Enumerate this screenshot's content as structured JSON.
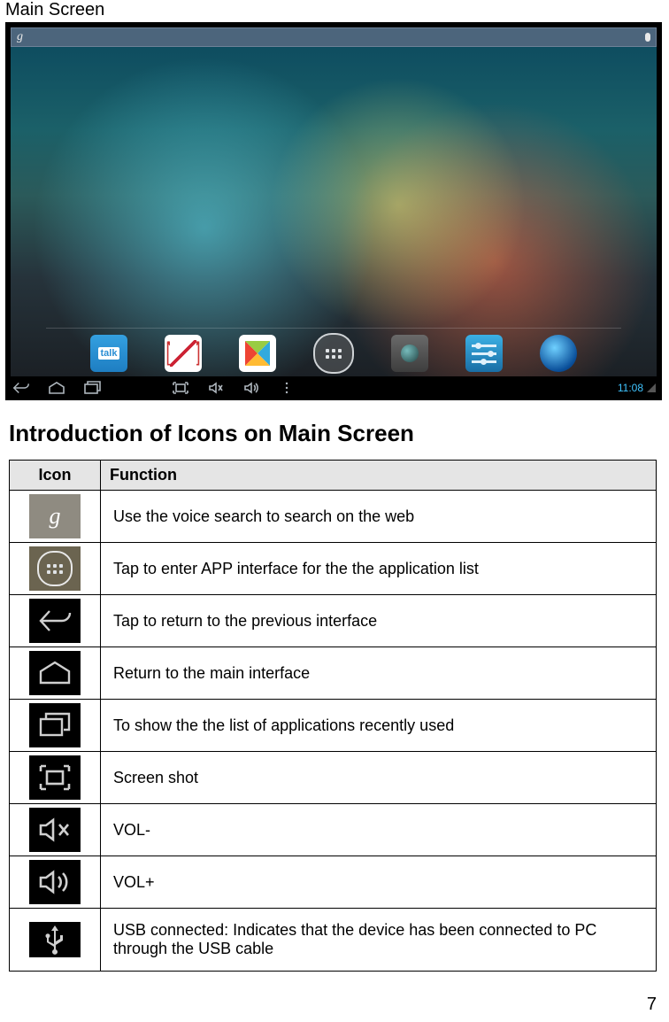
{
  "page_label": "Main Screen",
  "screenshot": {
    "search_letter": "g",
    "dock_apps": [
      "talk",
      "gmail",
      "play",
      "apps",
      "camera",
      "settings",
      "browser"
    ],
    "nav_icons": [
      "back",
      "home",
      "recent",
      "screenshot",
      "vol-down",
      "vol-up",
      "more"
    ],
    "clock": "11:08"
  },
  "heading": "Introduction of Icons on Main Screen",
  "table": {
    "headers": {
      "icon": "Icon",
      "fn": "Function"
    },
    "rows": [
      {
        "icon": "voice-search",
        "fn": "Use the voice search to search on the web"
      },
      {
        "icon": "apps-drawer",
        "fn": "Tap to enter APP interface for the the application list"
      },
      {
        "icon": "back",
        "fn": "Tap to return to the previous interface"
      },
      {
        "icon": "home",
        "fn": "Return to the main interface"
      },
      {
        "icon": "recent",
        "fn": "To show the the list of applications recently used"
      },
      {
        "icon": "screenshot",
        "fn": "Screen shot"
      },
      {
        "icon": "vol-down",
        "fn": "VOL-"
      },
      {
        "icon": "vol-up",
        "fn": "VOL+"
      },
      {
        "icon": "usb",
        "fn": "USB connected: Indicates that the device has been connected to PC through the USB cable"
      }
    ]
  },
  "page_number": "7"
}
